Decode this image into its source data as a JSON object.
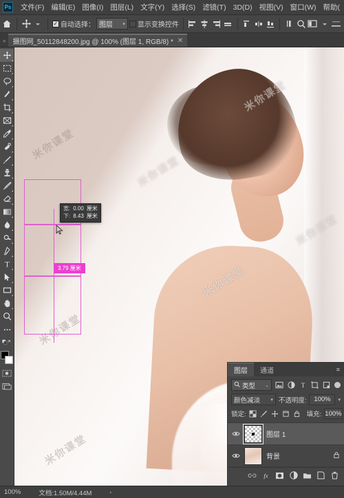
{
  "app": {
    "logo_text": "Ps",
    "menu": [
      {
        "label": "文件(F)",
        "name": "menu-file"
      },
      {
        "label": "编辑(E)",
        "name": "menu-edit"
      },
      {
        "label": "图像(I)",
        "name": "menu-image"
      },
      {
        "label": "图层(L)",
        "name": "menu-layer"
      },
      {
        "label": "文字(Y)",
        "name": "menu-type"
      },
      {
        "label": "选择(S)",
        "name": "menu-select"
      },
      {
        "label": "滤镜(T)",
        "name": "menu-filter"
      },
      {
        "label": "3D(D)",
        "name": "menu-3d"
      },
      {
        "label": "视图(V)",
        "name": "menu-view"
      },
      {
        "label": "窗口(W)",
        "name": "menu-window"
      },
      {
        "label": "帮助(",
        "name": "menu-help"
      }
    ],
    "window_controls": {
      "minimize": "—",
      "maximize": "□",
      "close": "✕"
    }
  },
  "options_bar": {
    "home_tooltip": "主页",
    "tool_move": "移动工具",
    "auto_select_checked": true,
    "auto_select_label": "自动选择：",
    "auto_select_target": "图层",
    "show_transform_checked": false,
    "show_transform_label": "显示变换控件",
    "align_group": [
      "左对齐",
      "水平居中对齐",
      "右对齐",
      "顶对齐"
    ],
    "distribute_group": [
      "垂直分布",
      "水平居中分布",
      "水平分布"
    ],
    "extras": [
      "3D模式",
      "搜索",
      "排列文档"
    ]
  },
  "document": {
    "tab_title": "摄图网_50112848200.jpg @ 100% (图层 1, RGB/8) *",
    "close_glyph": "✕",
    "overflow_glyph": "»"
  },
  "toolbar": {
    "tools": [
      {
        "name": "move-tool",
        "label": "移动工具",
        "active": true
      },
      {
        "name": "marquee-tool",
        "label": "矩形选框工具"
      },
      {
        "name": "lasso-tool",
        "label": "套索工具"
      },
      {
        "name": "quick-select-tool",
        "label": "快速选择工具"
      },
      {
        "name": "crop-tool",
        "label": "裁剪工具"
      },
      {
        "name": "frame-tool",
        "label": "画框工具"
      },
      {
        "name": "eyedropper-tool",
        "label": "吸管工具"
      },
      {
        "name": "healing-brush-tool",
        "label": "修复画笔工具"
      },
      {
        "name": "brush-tool",
        "label": "画笔工具"
      },
      {
        "name": "clone-stamp-tool",
        "label": "仿制图章工具"
      },
      {
        "name": "history-brush-tool",
        "label": "历史记录画笔工具"
      },
      {
        "name": "eraser-tool",
        "label": "橡皮擦工具"
      },
      {
        "name": "gradient-tool",
        "label": "渐变工具"
      },
      {
        "name": "blur-tool",
        "label": "模糊工具"
      },
      {
        "name": "dodge-tool",
        "label": "减淡工具"
      },
      {
        "name": "pen-tool",
        "label": "钢笔工具"
      },
      {
        "name": "type-tool",
        "label": "横排文字工具"
      },
      {
        "name": "path-select-tool",
        "label": "路径选择工具"
      },
      {
        "name": "rectangle-tool",
        "label": "矩形工具"
      },
      {
        "name": "hand-tool",
        "label": "抓手工具"
      },
      {
        "name": "zoom-tool",
        "label": "缩放工具"
      },
      {
        "name": "more-tools",
        "label": "编辑工具栏"
      }
    ],
    "quick-mask": "以快速蒙版模式编辑",
    "screen-mode": "更改屏幕模式",
    "foreground_color": "#000000",
    "background_color": "#ffffff"
  },
  "canvas": {
    "watermarks": [
      "米你课堂",
      "米你课堂",
      "米你课堂",
      "米你课堂",
      "米你课堂",
      "米你课堂",
      "米你课堂"
    ],
    "measure_tooltip": {
      "row1_key": "宽:",
      "row1_value": "0.00",
      "row1_unit": "厘米",
      "row2_key": "下:",
      "row2_value": "8.43",
      "row2_unit": "厘米"
    },
    "measure_badge": "3.79 厘米",
    "path_color": "#e05fd0"
  },
  "layers_panel": {
    "tabs": [
      {
        "label": "图层",
        "active": true,
        "name": "tab-layers"
      },
      {
        "label": "通道",
        "active": false,
        "name": "tab-channels"
      }
    ],
    "menu_glyph": "≡",
    "filter": {
      "search_icon": "search-icon",
      "kind_label": "类型",
      "caret": "⌄",
      "icons": [
        "pixel-filter-icon",
        "adjustment-filter-icon",
        "type-filter-icon",
        "shape-filter-icon",
        "smart-object-filter-icon"
      ],
      "toggle": "filter-toggle"
    },
    "blend_mode": "颜色减淡",
    "opacity_label": "不透明度:",
    "opacity_value": "100%",
    "lock_label": "锁定:",
    "lock_icons": [
      "lock-transparent-icon",
      "lock-image-icon",
      "lock-position-icon",
      "lock-artboard-icon",
      "lock-all-icon"
    ],
    "fill_label": "填充:",
    "fill_value": "100%",
    "layers": [
      {
        "name": "图层 1",
        "selected": true,
        "locked": false,
        "visible": true,
        "thumb": "transparent"
      },
      {
        "name": "背景",
        "selected": false,
        "locked": true,
        "visible": true,
        "thumb": "photo"
      }
    ],
    "footer_buttons": [
      {
        "name": "link-layers-button",
        "glyph": "⛓"
      },
      {
        "name": "layer-style-button",
        "glyph": "fx"
      },
      {
        "name": "layer-mask-button",
        "glyph": "◧"
      },
      {
        "name": "adjustment-layer-button",
        "glyph": "◑"
      },
      {
        "name": "new-group-button",
        "glyph": "▰"
      },
      {
        "name": "new-layer-button",
        "glyph": "▢"
      },
      {
        "name": "delete-layer-button",
        "glyph": "🗑"
      }
    ]
  },
  "status_bar": {
    "zoom": "100%",
    "doc_label": "文档:",
    "doc_size": "1.50M/4.44M",
    "arrow": "›"
  },
  "colors": {
    "chrome": "#454545",
    "chrome_dark": "#3b3b3b",
    "accent_magenta": "#ec3fd0",
    "path_pink": "#e05fd0",
    "text": "#d6d6d6"
  }
}
